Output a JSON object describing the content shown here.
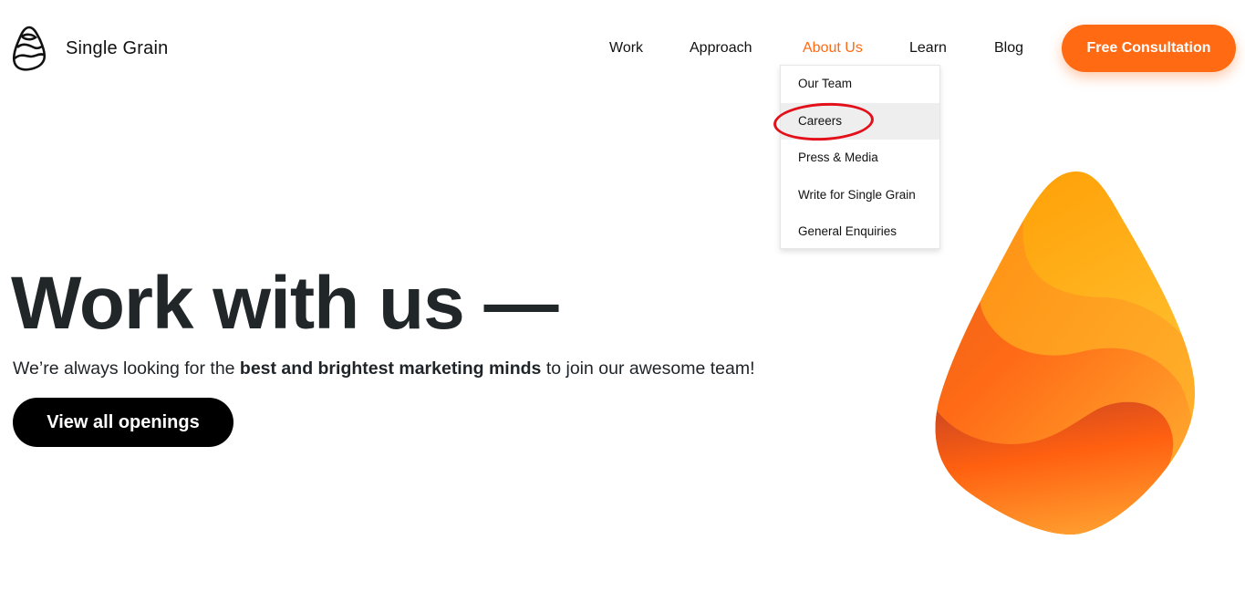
{
  "brand": {
    "name": "Single Grain",
    "accent_color": "#ff6a13",
    "logo_icon": "drop-logo-icon"
  },
  "nav": {
    "items": [
      {
        "label": "Work"
      },
      {
        "label": "Approach"
      },
      {
        "label": "About Us",
        "active": true
      },
      {
        "label": "Learn"
      },
      {
        "label": "Blog"
      }
    ],
    "cta_label": "Free Consultation"
  },
  "about_dropdown": {
    "items": [
      {
        "label": "Our Team"
      },
      {
        "label": "Careers",
        "highlighted": true
      },
      {
        "label": "Press & Media"
      },
      {
        "label": "Write for Single Grain"
      },
      {
        "label": "General Enquiries"
      }
    ]
  },
  "hero": {
    "title": "Work with us —",
    "subtitle_pre": "We’re always looking for the ",
    "subtitle_bold": "best and brightest marketing minds",
    "subtitle_post": " to join our awesome team!",
    "button_label": "View all openings",
    "illustration": "orange-drop-illustration"
  }
}
